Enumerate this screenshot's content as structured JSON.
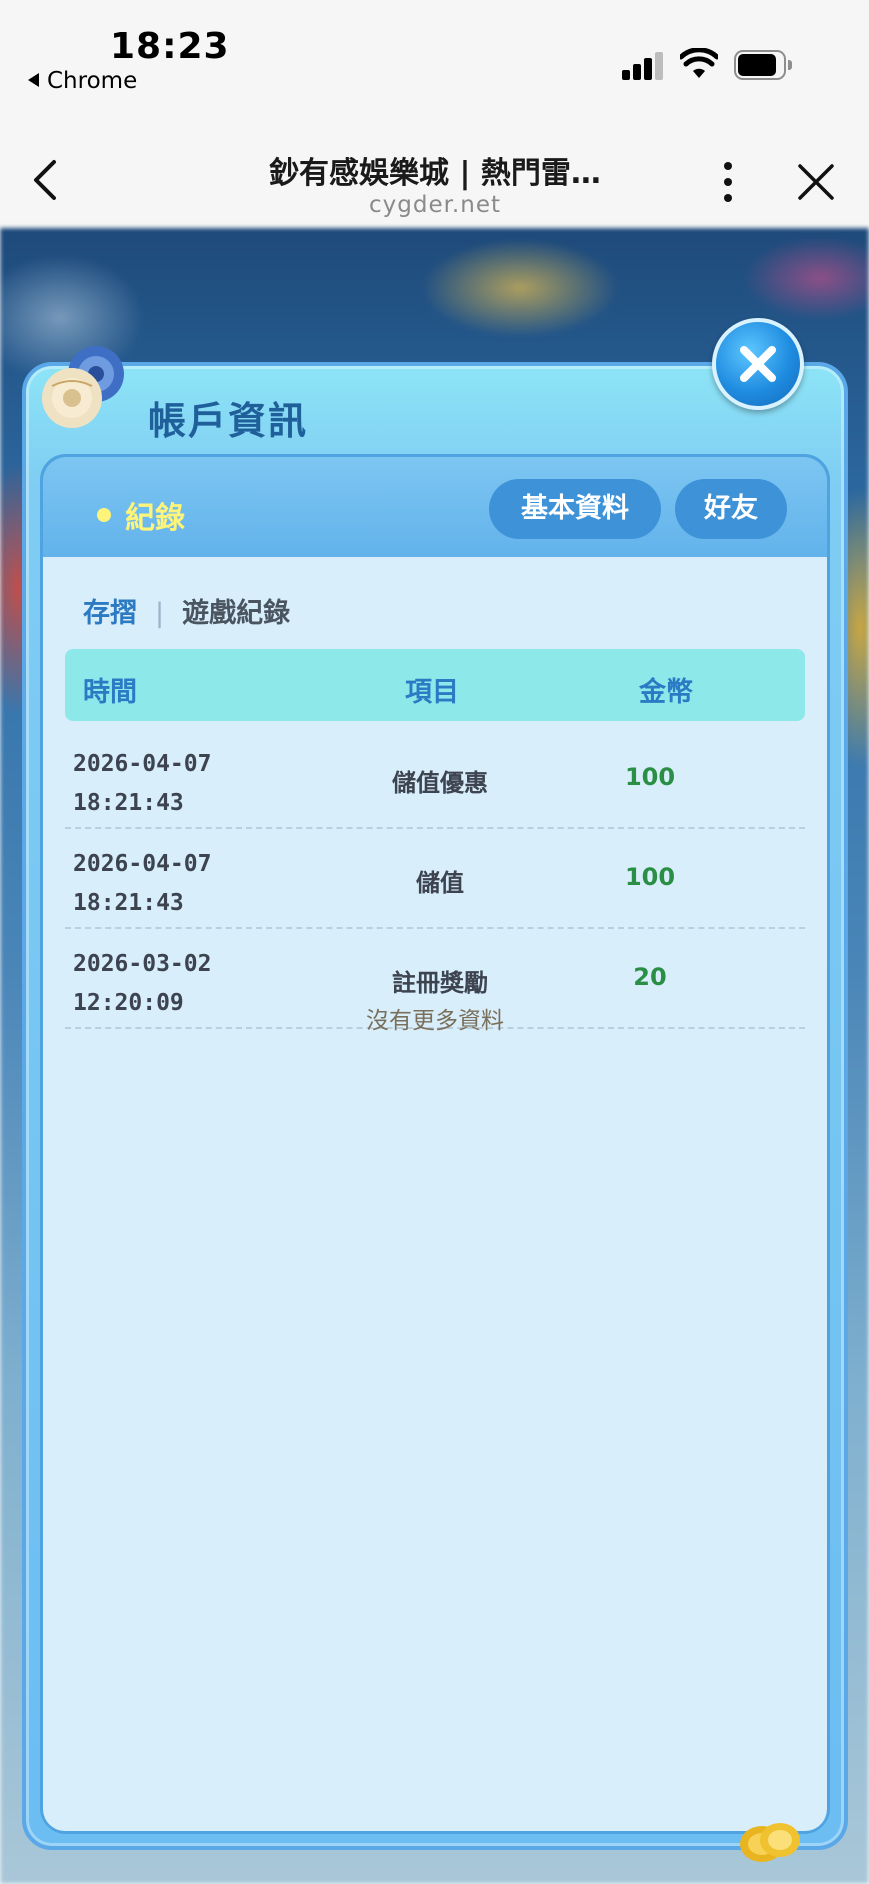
{
  "status_bar": {
    "time": "18:23",
    "back_app": "Chrome"
  },
  "browser": {
    "title": "鈔有感娛樂城 | 熱門雷…",
    "domain": "cygder.net"
  },
  "modal": {
    "title": "帳戶資訊",
    "tabs": {
      "active": "紀錄",
      "basic_info": "基本資料",
      "friends": "好友"
    },
    "subtabs": {
      "deposit": "存摺",
      "separator": "|",
      "game_records": "遊戲紀錄"
    },
    "table": {
      "headers": [
        "時間",
        "項目",
        "金幣"
      ],
      "rows": [
        {
          "date": "2026-04-07",
          "time": "18:21:43",
          "item": "儲值優惠",
          "coins": "100"
        },
        {
          "date": "2026-04-07",
          "time": "18:21:43",
          "item": "儲值",
          "coins": "100"
        },
        {
          "date": "2026-03-02",
          "time": "12:20:09",
          "item": "註冊獎勵",
          "coins": "20"
        }
      ],
      "footer": "沒有更多資料"
    }
  },
  "colors": {
    "title_blue": "#1f5f9a",
    "active_tab_yellow": "#fff47a",
    "coin_green": "#2a8f45",
    "header_cyan": "#8de8ea"
  },
  "icons": [
    "back-chevron-icon",
    "more-vertical-icon",
    "close-icon",
    "rose-icon",
    "modal-close-icon",
    "coin-icon",
    "signal-icon",
    "wifi-icon",
    "battery-icon"
  ]
}
